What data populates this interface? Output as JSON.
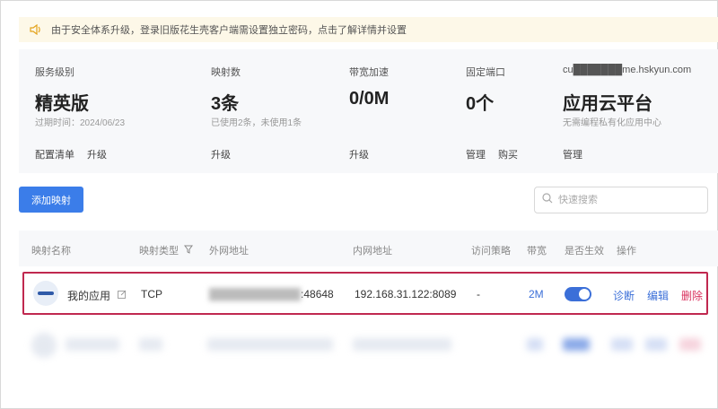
{
  "notice": {
    "text": "由于安全体系升级，登录旧版花生壳客户端需设置独立密码，点击了解详情并设置",
    "icon": "speaker-icon"
  },
  "stats": [
    {
      "label": "服务级别",
      "value": "精英版",
      "sub": "过期时间：2024/06/23",
      "links": [
        "配置清单",
        "升级"
      ]
    },
    {
      "label": "映射数",
      "value": "3条",
      "sub": "已使用2条，未使用1条",
      "links": [
        "升级"
      ]
    },
    {
      "label": "带宽加速",
      "value": "0/0M",
      "sub": "",
      "links": [
        "升级"
      ]
    },
    {
      "label": "固定端口",
      "value": "0个",
      "sub": "",
      "links": [
        "管理",
        "购买"
      ]
    },
    {
      "label": "cu███████me.hskyun.com",
      "value": "应用云平台",
      "sub": "无需编程私有化应用中心",
      "links": [
        "管理"
      ]
    }
  ],
  "toolbar": {
    "add_label": "添加映射",
    "search_placeholder": "快速搜索"
  },
  "table": {
    "headers": [
      "映射名称",
      "映射类型",
      "外网地址",
      "内网地址",
      "访问策略",
      "带宽",
      "是否生效",
      "操作"
    ],
    "row": {
      "name": "我的应用",
      "type": "TCP",
      "external_masked": "████████████",
      "external_port": ":48648",
      "internal": "192.168.31.122:8089",
      "policy": "-",
      "bandwidth": "2M",
      "enabled": true,
      "actions": [
        "诊断",
        "编辑",
        "删除"
      ]
    }
  },
  "colors": {
    "primary": "#3b7de9",
    "highlight_border": "#c0284f",
    "delete": "#d9325e",
    "notice_bg": "#fdf8e8"
  }
}
